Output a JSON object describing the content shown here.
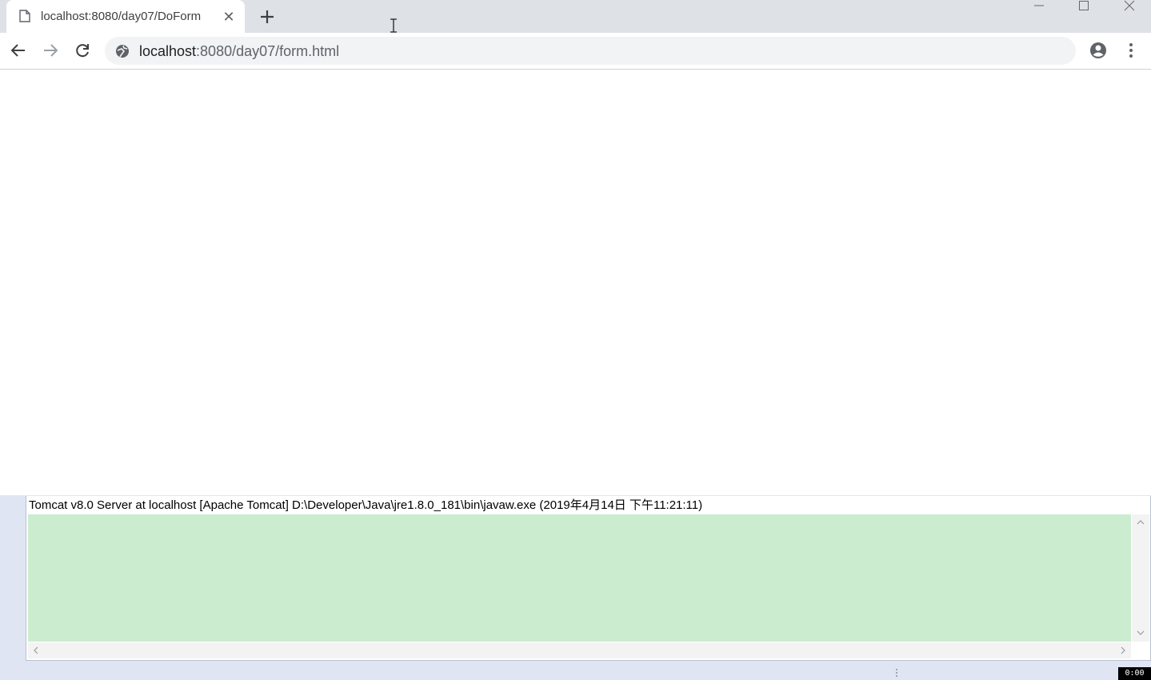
{
  "browser": {
    "tab": {
      "title": "localhost:8080/day07/DoForm",
      "close_glyph": "✕"
    },
    "address_bar": {
      "host": "localhost",
      "rest": ":8080/day07/form.html"
    }
  },
  "console": {
    "header": "Tomcat v8.0 Server at localhost [Apache Tomcat] D:\\Developer\\Java\\jre1.8.0_181\\bin\\javaw.exe (2019年4月14日 下午11:21:11)"
  },
  "overlay": {
    "timer": "0:00"
  },
  "colors": {
    "titlebar": "#dee1e6",
    "omnibox": "#f1f3f4",
    "console_output": "#cbeccf",
    "ide_background": "#dfe5f3"
  }
}
